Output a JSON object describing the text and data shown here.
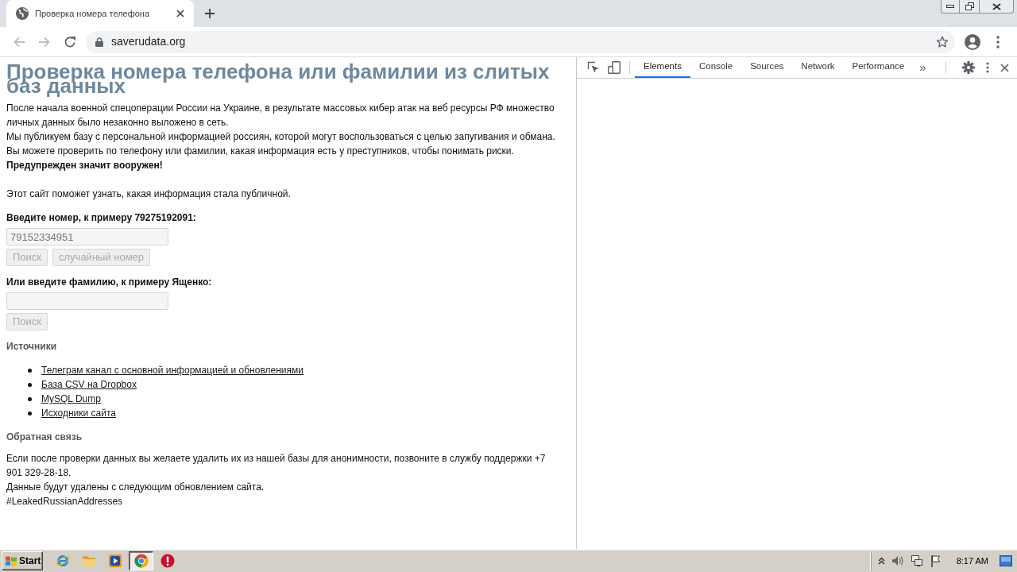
{
  "browser": {
    "tabs": [
      {
        "title": "Проверка номера телефона",
        "selected": true
      }
    ],
    "back": {
      "disabled": true
    },
    "forward": {
      "disabled": true
    },
    "address": "saverudata.org"
  },
  "page": {
    "title": "Проверка номера телефона или фамилии из слитых баз данных",
    "intro": [
      {
        "kind": "plain",
        "text": "После начала военной спецоперации России на Украине, в результате массовых кибер атак на веб ресурсы РФ множество личных данных было незаконно выложено в сеть."
      },
      {
        "kind": "plain",
        "text": "Мы публикуем базу с персональной информацией россиян, которой могут воспользоваться с целью запугивания и обмана."
      },
      {
        "kind": "plain",
        "text": "Вы можете проверить по телефону или фамилии, какая информация есть у преступников, чтобы понимать риски."
      },
      {
        "kind": "strong",
        "text": "Предупрежден значит вооружен!"
      }
    ],
    "note": "Этот сайт поможет узнать, какая информация стала публичной.",
    "phone_search": {
      "label": "Введите номер, к примеру 79275192091:",
      "field": {
        "value": "79152334951",
        "disabled": true
      },
      "buttons": [
        {
          "label": "Поиск",
          "disabled": true
        },
        {
          "label": "случайный номер",
          "disabled": true
        }
      ]
    },
    "surname_search": {
      "label": "Или введите фамилию, к примеру Ященко:",
      "field": {
        "disabled": true
      },
      "buttons": [
        {
          "label": "Поиск",
          "disabled": true
        }
      ]
    },
    "sources": {
      "heading": "Источники",
      "links": [
        "Телеграм канал с основной информацией и обновлениями",
        "База CSV на Dropbox",
        "MySQL Dump",
        "Исходники сайта"
      ]
    },
    "feedback": {
      "heading": "Обратная связь",
      "paragraphs": [
        "Если после проверки данных вы желаете удалить их из нашей базы для анонимности, позвоните в службу поддержки +7 901 329-28-18.",
        "Данные будут удалены с следующим обновлением сайта.",
        "#LeakedRussianAddresses"
      ]
    }
  },
  "devtools": {
    "tabs": [
      {
        "label": "Elements",
        "selected": true
      },
      {
        "label": "Console",
        "selected": false
      },
      {
        "label": "Sources",
        "selected": false
      },
      {
        "label": "Network",
        "selected": false
      },
      {
        "label": "Performance",
        "selected": false
      }
    ],
    "overflow": "»"
  },
  "taskbar": {
    "start": "Start",
    "apps": [
      {
        "kind": "ring",
        "active": false
      },
      {
        "kind": "folder",
        "active": false
      },
      {
        "kind": "player",
        "active": false
      },
      {
        "kind": "wheel",
        "active": true
      },
      {
        "kind": "alert",
        "active": false
      }
    ],
    "clock": "8:17 AM"
  }
}
